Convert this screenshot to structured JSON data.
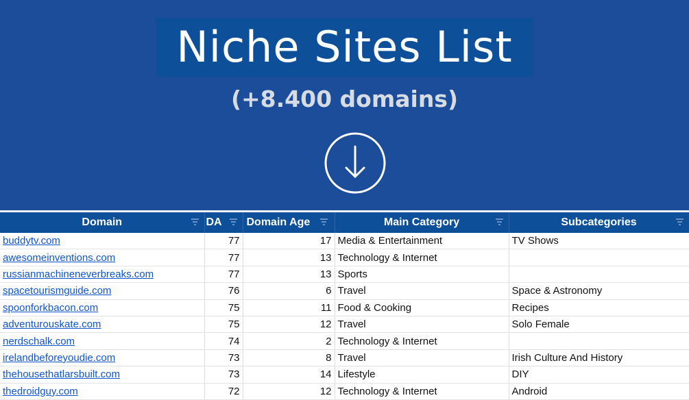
{
  "hero": {
    "title": "Niche Sites List",
    "subtitle": "(+8.400 domains)",
    "icon": "arrow-down-circle-icon"
  },
  "table": {
    "headers": [
      "Domain",
      "DA",
      "Domain Age",
      "Main Category",
      "Subcategories"
    ],
    "rows": [
      {
        "domain": "buddytv.com",
        "da": "77",
        "age": "17",
        "category": "Media & Entertainment",
        "sub": "TV Shows"
      },
      {
        "domain": "awesomeinventions.com",
        "da": "77",
        "age": "13",
        "category": "Technology & Internet",
        "sub": ""
      },
      {
        "domain": "russianmachineneverbreaks.com",
        "da": "77",
        "age": "13",
        "category": "Sports",
        "sub": ""
      },
      {
        "domain": "spacetourismguide.com",
        "da": "76",
        "age": "6",
        "category": "Travel",
        "sub": "Space & Astronomy"
      },
      {
        "domain": "spoonforkbacon.com",
        "da": "75",
        "age": "11",
        "category": "Food & Cooking",
        "sub": "Recipes"
      },
      {
        "domain": "adventurouskate.com",
        "da": "75",
        "age": "12",
        "category": "Travel",
        "sub": "Solo Female"
      },
      {
        "domain": "nerdschalk.com",
        "da": "74",
        "age": "2",
        "category": "Technology & Internet",
        "sub": ""
      },
      {
        "domain": "irelandbeforeyoudie.com",
        "da": "73",
        "age": "8",
        "category": "Travel",
        "sub": "Irish Culture And History"
      },
      {
        "domain": "thehousethatlarsbuilt.com",
        "da": "73",
        "age": "14",
        "category": "Lifestyle",
        "sub": "DIY"
      },
      {
        "domain": "thedroidguy.com",
        "da": "72",
        "age": "12",
        "category": "Technology & Internet",
        "sub": "Android"
      }
    ]
  },
  "colors": {
    "background": "#1c4d9a",
    "header": "#0d4f99",
    "link": "#1155cc"
  }
}
